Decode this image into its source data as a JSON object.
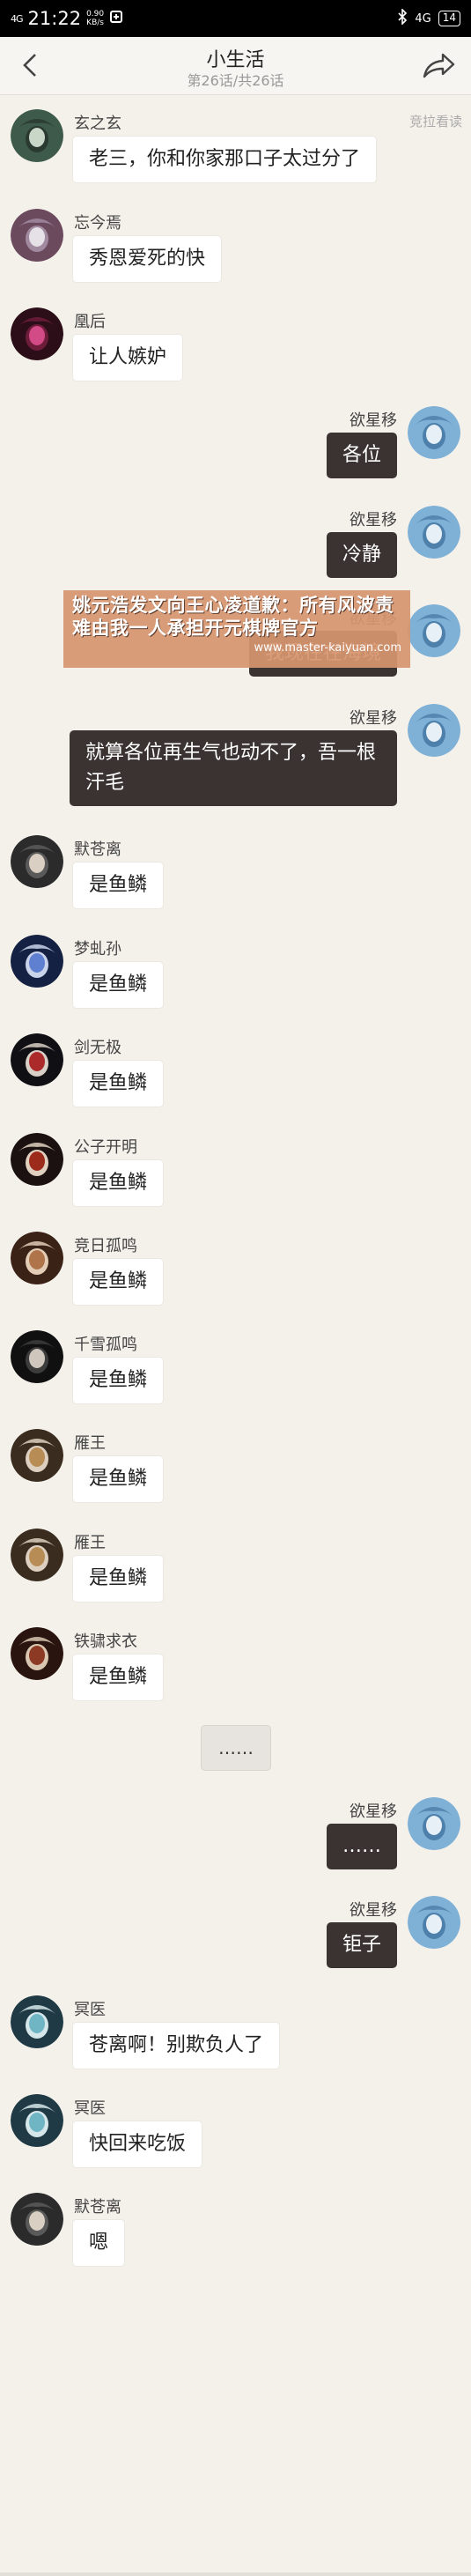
{
  "statusbar": {
    "signal": "4G",
    "time": "21:22",
    "speed": "0.90",
    "speed_unit": "KB/s",
    "network": "4G",
    "battery": "14"
  },
  "header": {
    "title": "小生活",
    "subtitle": "第26话/共26话",
    "side_note": "竞拉看读"
  },
  "colors": {
    "background": "#f4f1eb",
    "own_bubble": "#3a3332",
    "other_bubble": "#ffffff",
    "watermark": "#d69670"
  },
  "messages": [
    {
      "side": "left",
      "name": "玄之玄",
      "text": "老三，你和你家那口子太过分了",
      "avatar": "avatar-green-hair"
    },
    {
      "side": "left",
      "name": "忘今焉",
      "text": "秀恩爱死的快",
      "avatar": "avatar-white-hair"
    },
    {
      "side": "left",
      "name": "凰后",
      "text": "让人嫉妒",
      "avatar": "avatar-pink"
    },
    {
      "side": "right",
      "name": "欲星移",
      "text": "各位",
      "avatar": "avatar-blue-hair"
    },
    {
      "side": "right",
      "name": "欲星移",
      "text": "冷静",
      "avatar": "avatar-blue-hair"
    },
    {
      "side": "right",
      "name": "欲星移",
      "text": "我现在在海境",
      "avatar": "avatar-blue-hair"
    },
    {
      "side": "right",
      "name": "欲星移",
      "text": "就算各位再生气也动不了，吾一根汗毛",
      "avatar": "avatar-blue-hair"
    },
    {
      "side": "left",
      "name": "默苍离",
      "text": "是鱼鳞",
      "avatar": "avatar-dark-hair"
    },
    {
      "side": "left",
      "name": "梦虬孙",
      "text": "是鱼鳞",
      "avatar": "avatar-blue-spiky"
    },
    {
      "side": "left",
      "name": "剑无极",
      "text": "是鱼鳞",
      "avatar": "avatar-black-red"
    },
    {
      "side": "left",
      "name": "公子开明",
      "text": "是鱼鳞",
      "avatar": "avatar-red-hat"
    },
    {
      "side": "left",
      "name": "竞日孤鸣",
      "text": "是鱼鳞",
      "avatar": "avatar-brown"
    },
    {
      "side": "left",
      "name": "千雪孤鸣",
      "text": "是鱼鳞",
      "avatar": "avatar-black"
    },
    {
      "side": "left",
      "name": "雁王",
      "text": "是鱼鳞",
      "avatar": "avatar-gold"
    },
    {
      "side": "left",
      "name": "雁王",
      "text": "是鱼鳞",
      "avatar": "avatar-gold"
    },
    {
      "side": "left",
      "name": "铁骕求衣",
      "text": "是鱼鳞",
      "avatar": "avatar-dark-red"
    },
    {
      "side": "right",
      "name": "欲星移",
      "text": "……",
      "avatar": "avatar-blue-hair"
    },
    {
      "side": "right",
      "name": "欲星移",
      "text": "钜子",
      "avatar": "avatar-blue-hair"
    },
    {
      "side": "left",
      "name": "冥医",
      "text": "苍离啊！别欺负人了",
      "avatar": "avatar-teal"
    },
    {
      "side": "left",
      "name": "冥医",
      "text": "快回来吃饭",
      "avatar": "avatar-teal"
    },
    {
      "side": "left",
      "name": "默苍离",
      "text": "嗯",
      "avatar": "avatar-dark-hair"
    }
  ],
  "system_bubble": "……",
  "watermark": {
    "line1": "姚元浩发文向王心凌道歉：所有风波责难由我一人承担",
    "line1_tail": "开元棋牌官方",
    "line2": "www.master-kaiyuan.com"
  }
}
